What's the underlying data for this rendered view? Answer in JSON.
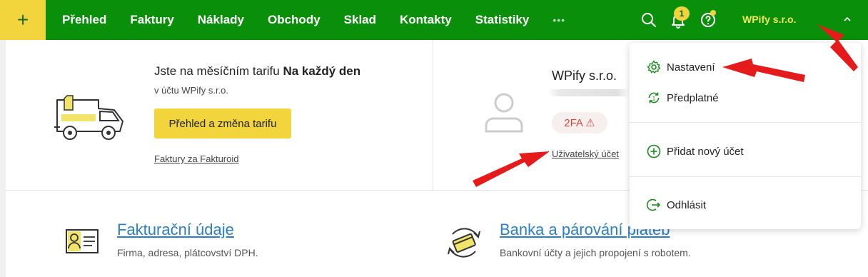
{
  "nav": {
    "add_label": "+",
    "items": [
      "Přehled",
      "Faktury",
      "Náklady",
      "Obchody",
      "Sklad",
      "Kontakty",
      "Statistiky"
    ],
    "more": "•••",
    "notification_count": "1",
    "company": "WPify s.r.o."
  },
  "tariff": {
    "text": "Jste na měsíčním tarifu ",
    "plan": "Na každý den",
    "account_line": "v účtu WPify s.r.o.",
    "button": "Přehled a změna tarifu",
    "invoices_link": "Faktury za Fakturoid"
  },
  "account": {
    "name": "WPify s.r.o.",
    "twofa_label": "2FA ⚠",
    "user_account_link": "Uživatelský účet"
  },
  "sections": {
    "billing": {
      "title": "Fakturační údaje",
      "desc": "Firma, adresa, plátcovství DPH."
    },
    "bank": {
      "title": "Banka a párování plateb",
      "desc": "Bankovní účty a jejich propojení s robotem."
    }
  },
  "dropdown": {
    "items": [
      "Nastavení",
      "Předplatné",
      "Přidat nový účet",
      "Odhlásit"
    ]
  },
  "colors": {
    "nav_green": "#0a8f0a",
    "accent_yellow": "#f2d43d",
    "link_blue": "#2a7fc6",
    "arrow_red": "#e51a1a"
  }
}
